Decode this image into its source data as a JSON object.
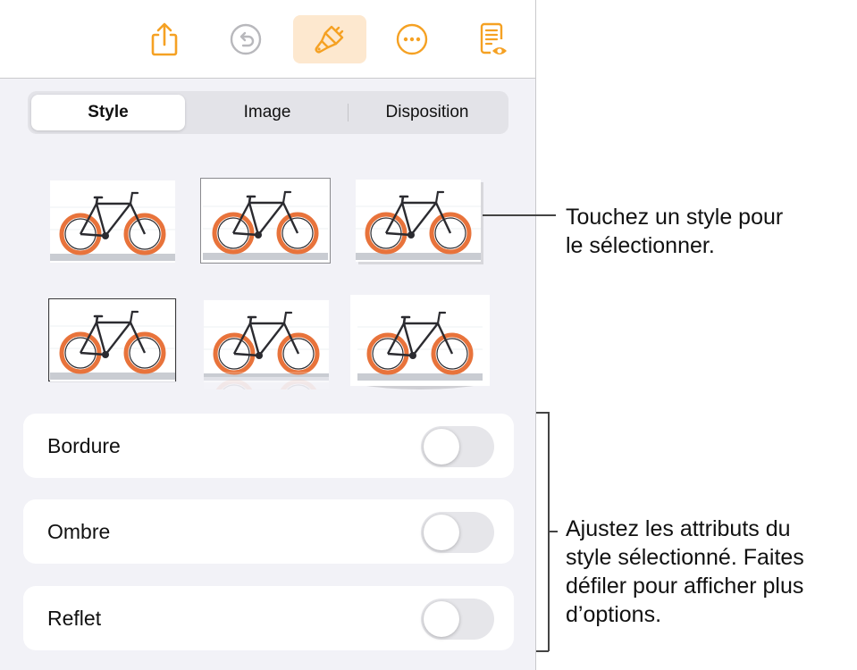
{
  "toolbar": {
    "buttons": [
      {
        "name": "share-icon",
        "active": false
      },
      {
        "name": "undo-icon",
        "active": false
      },
      {
        "name": "format-brush-icon",
        "active": true
      },
      {
        "name": "more-icon",
        "active": false
      },
      {
        "name": "reader-view-icon",
        "active": false
      }
    ],
    "accent": "#f5a123"
  },
  "tabs": [
    {
      "label": "Style",
      "selected": true
    },
    {
      "label": "Image",
      "selected": false
    },
    {
      "label": "Disposition",
      "selected": false
    }
  ],
  "style_presets": {
    "count": 6,
    "selected_index": 1
  },
  "options": [
    {
      "label": "Bordure",
      "on": false
    },
    {
      "label": "Ombre",
      "on": false
    },
    {
      "label": "Reflet",
      "on": false
    }
  ],
  "callouts": {
    "top": [
      "Touchez un style pour",
      "le sélectionner."
    ],
    "bottom": [
      "Ajustez les attributs du",
      "style sélectionné. Faites",
      "défiler pour afficher plus",
      "d’options."
    ]
  }
}
